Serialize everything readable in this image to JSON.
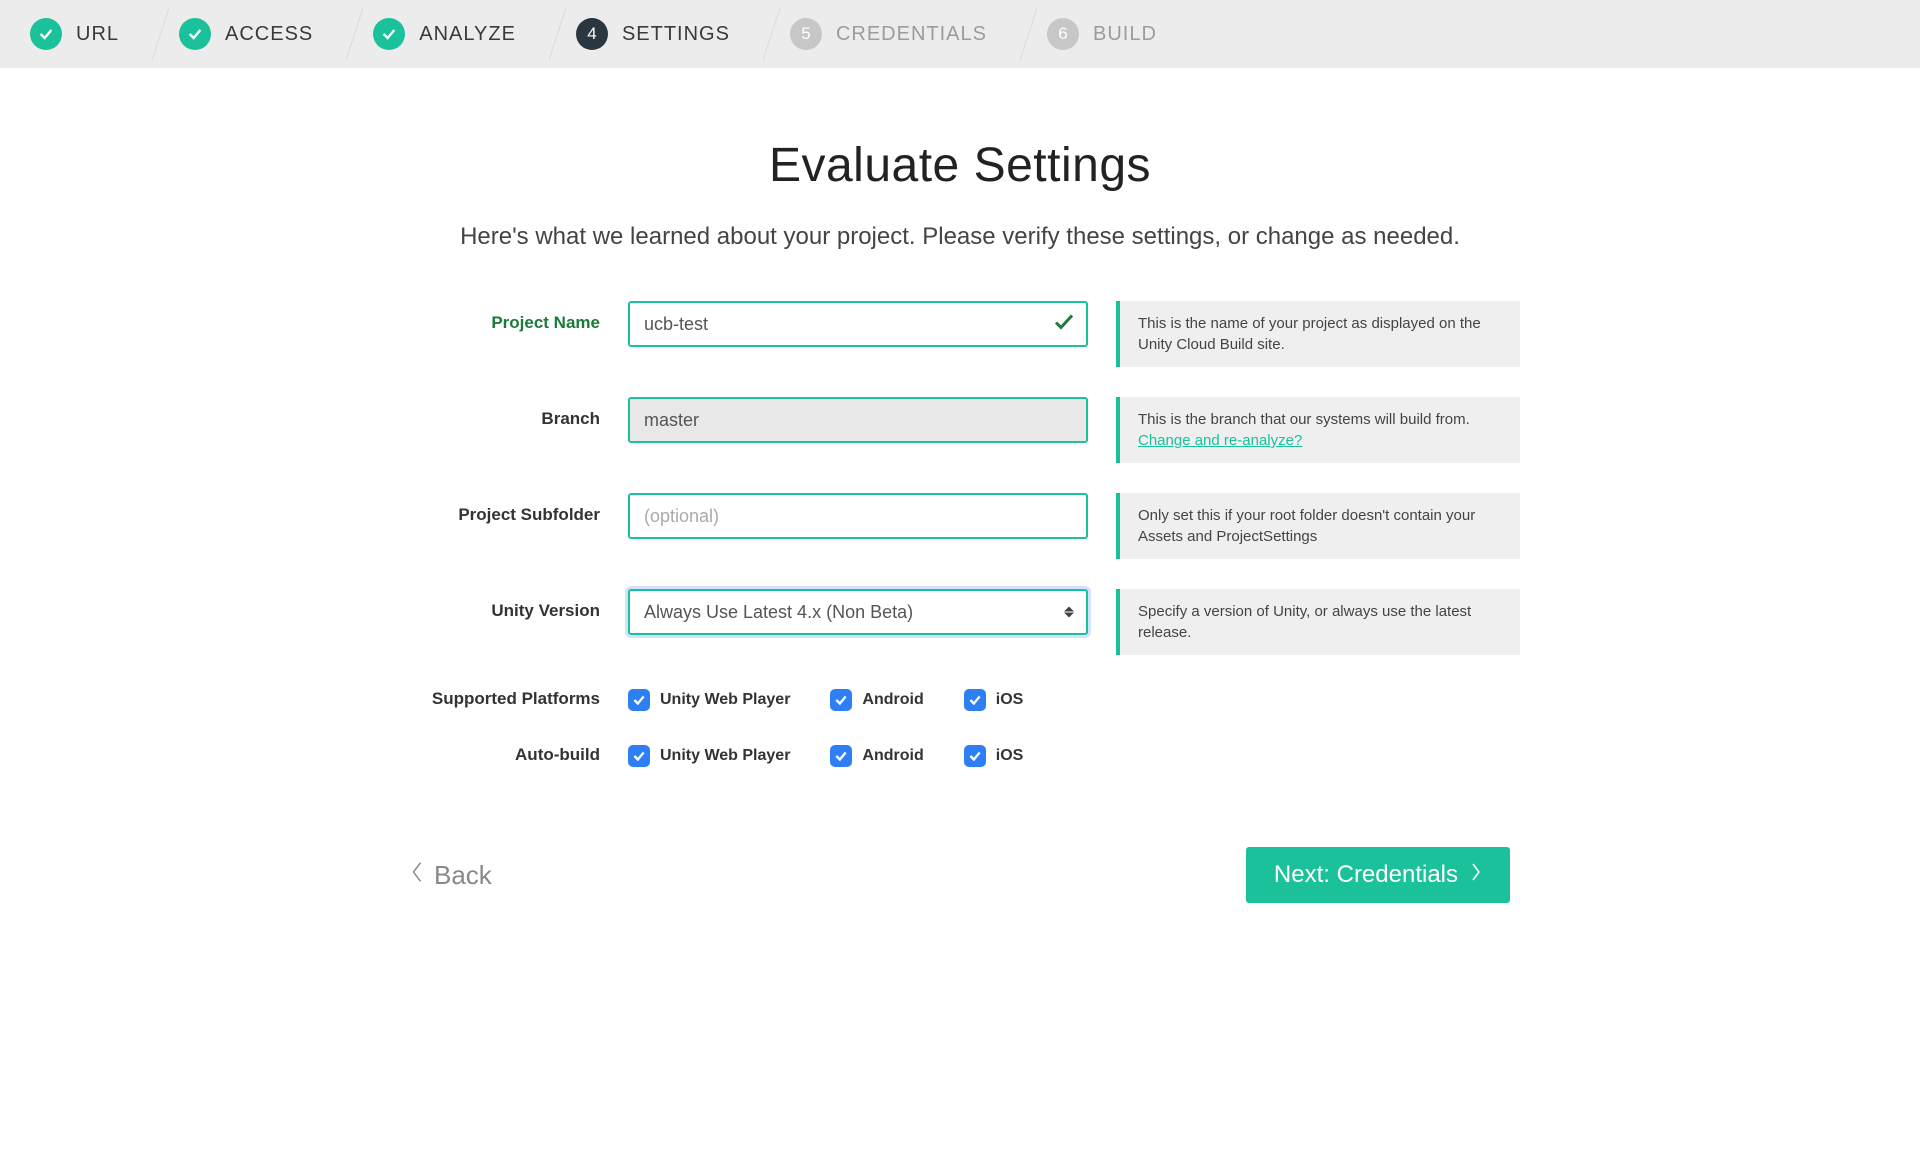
{
  "stepper": {
    "steps": [
      {
        "label": "URL",
        "state": "done"
      },
      {
        "label": "ACCESS",
        "state": "done"
      },
      {
        "label": "ANALYZE",
        "state": "done"
      },
      {
        "label": "SETTINGS",
        "state": "active",
        "number": "4"
      },
      {
        "label": "CREDENTIALS",
        "state": "future",
        "number": "5"
      },
      {
        "label": "BUILD",
        "state": "future",
        "number": "6"
      }
    ]
  },
  "page": {
    "title": "Evaluate Settings",
    "subtitle": "Here's what we learned about your project. Please verify these settings, or change as needed."
  },
  "form": {
    "project_name": {
      "label": "Project Name",
      "value": "ucb-test",
      "hint": "This is the name of your project as displayed on the Unity Cloud Build site."
    },
    "branch": {
      "label": "Branch",
      "value": "master",
      "hint": "This is the branch that our systems will build from.",
      "hint_link": "Change and re-analyze?"
    },
    "subfolder": {
      "label": "Project Subfolder",
      "value": "",
      "placeholder": "(optional)",
      "hint": "Only set this if your root folder doesn't contain your Assets and ProjectSettings"
    },
    "unity_version": {
      "label": "Unity Version",
      "value": "Always Use Latest 4.x (Non Beta)",
      "hint": "Specify a version of Unity, or always use the latest release."
    },
    "supported_platforms": {
      "label": "Supported Platforms",
      "options": [
        {
          "label": "Unity Web Player",
          "checked": true
        },
        {
          "label": "Android",
          "checked": true
        },
        {
          "label": "iOS",
          "checked": true
        }
      ]
    },
    "auto_build": {
      "label": "Auto-build",
      "options": [
        {
          "label": "Unity Web Player",
          "checked": true
        },
        {
          "label": "Android",
          "checked": true
        },
        {
          "label": "iOS",
          "checked": true
        }
      ]
    }
  },
  "footer": {
    "back": "Back",
    "next": "Next: Credentials"
  }
}
